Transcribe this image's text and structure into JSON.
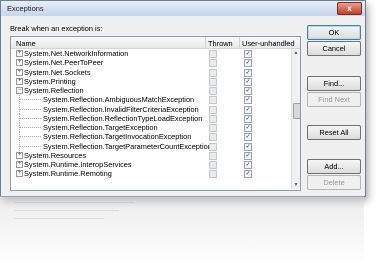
{
  "window": {
    "title": "Exceptions",
    "close_glyph": "x"
  },
  "break_label": "Break when an exception is:",
  "columns": {
    "name": "Name",
    "thrown": "Thrown",
    "user_unhandled": "User-unhandled"
  },
  "rows": [
    {
      "name": "System.Net.NetworkInformation",
      "level": 0,
      "expander": "+",
      "thrown": false,
      "user_unhandled": true
    },
    {
      "name": "System.Net.PeerToPeer",
      "level": 0,
      "expander": "+",
      "thrown": false,
      "user_unhandled": true
    },
    {
      "name": "System.Net.Sockets",
      "level": 0,
      "expander": "+",
      "thrown": false,
      "user_unhandled": true
    },
    {
      "name": "System.Printing",
      "level": 0,
      "expander": "+",
      "thrown": false,
      "user_unhandled": true
    },
    {
      "name": "System.Reflection",
      "level": 0,
      "expander": "−",
      "thrown": false,
      "user_unhandled": true
    },
    {
      "name": "System.Reflection.AmbiguousMatchException",
      "level": 1,
      "expander": "",
      "thrown": false,
      "user_unhandled": true
    },
    {
      "name": "System.Reflection.InvalidFilterCriteriaException",
      "level": 1,
      "expander": "",
      "thrown": false,
      "user_unhandled": true
    },
    {
      "name": "System.Reflection.ReflectionTypeLoadException",
      "level": 1,
      "expander": "",
      "thrown": false,
      "user_unhandled": true
    },
    {
      "name": "System.Reflection.TargetException",
      "level": 1,
      "expander": "",
      "thrown": false,
      "user_unhandled": true
    },
    {
      "name": "System.Reflection.TargetInvocationException",
      "level": 1,
      "expander": "",
      "thrown": false,
      "user_unhandled": true
    },
    {
      "name": "System.Reflection.TargetParameterCountException",
      "level": 1,
      "expander": "",
      "thrown": false,
      "user_unhandled": true
    },
    {
      "name": "System.Resources",
      "level": 0,
      "expander": "+",
      "thrown": false,
      "user_unhandled": true
    },
    {
      "name": "System.Runtime.InteropServices",
      "level": 0,
      "expander": "+",
      "thrown": false,
      "user_unhandled": true
    },
    {
      "name": "System.Runtime.Remoting",
      "level": 0,
      "expander": "+",
      "thrown": false,
      "user_unhandled": true
    }
  ],
  "buttons": {
    "ok": "OK",
    "cancel": "Cancel",
    "find": "Find...",
    "find_next": "Find Next",
    "reset_all": "Reset All",
    "add": "Add...",
    "delete": "Delete"
  },
  "icons": {
    "expand": "plus-icon",
    "collapse": "minus-icon",
    "check": "checkmark-icon"
  },
  "colors": {
    "title_bar": "#c7d6ea",
    "close_button": "#c0402a",
    "grid_border": "#8e9aa8"
  }
}
